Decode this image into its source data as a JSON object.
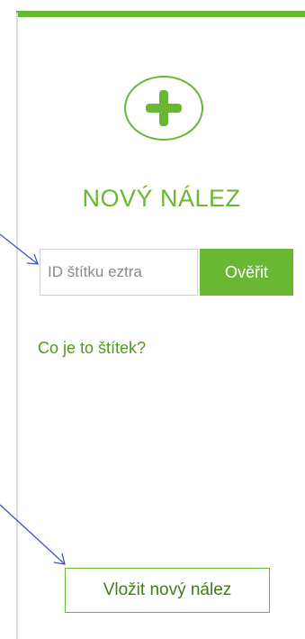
{
  "panel": {
    "title": "NOVÝ NÁLEZ",
    "add_icon": "plus-icon",
    "accent_color": "#69b833"
  },
  "tag_form": {
    "input_placeholder": "ID štítku eztra",
    "verify_label": "Ověřit"
  },
  "help_link": {
    "label": "Co je to štítek?"
  },
  "new_find_button": {
    "label": "Vložit nový nález"
  },
  "annotation_arrows": {
    "color": "#3a4fc0"
  }
}
